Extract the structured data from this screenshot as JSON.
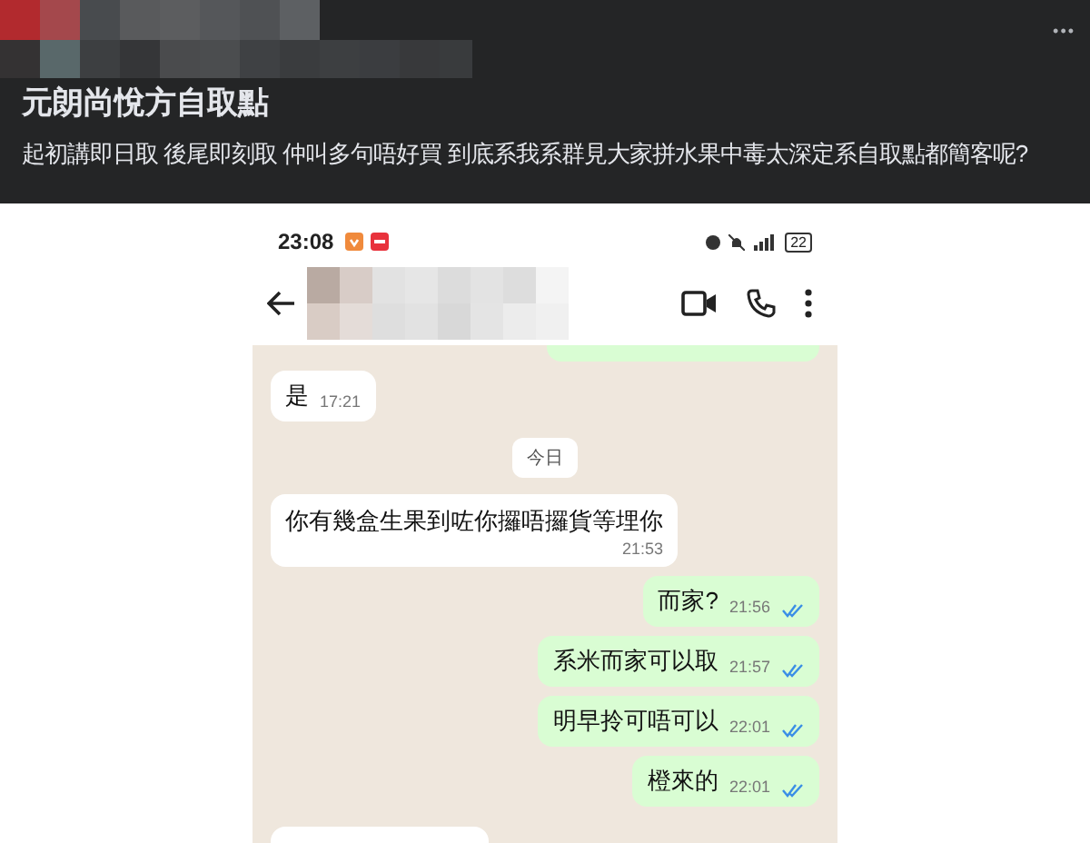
{
  "post": {
    "title": "元朗尚悅方自取點",
    "body": "起初講即日取 後尾即刻取 仲叫多句唔好買 到底系我系群見大家拼水果中毒太深定系自取點都簡客呢?",
    "menu_icon": "•••"
  },
  "phone": {
    "status_time": "23:08",
    "battery": "22",
    "messages": [
      {
        "kind": "sent_cut"
      },
      {
        "kind": "received",
        "text": "是",
        "time": "17:21"
      },
      {
        "kind": "date",
        "text": "今日"
      },
      {
        "kind": "received_wide",
        "text": "你有幾盒生果到咗你攞唔攞貨等埋你",
        "time": "21:53"
      },
      {
        "kind": "sent",
        "text": "而家?",
        "time": "21:56",
        "read": true
      },
      {
        "kind": "sent",
        "text": "系米而家可以取",
        "time": "21:57",
        "read": true
      },
      {
        "kind": "sent",
        "text": "明早拎可唔可以",
        "time": "22:01",
        "read": true
      },
      {
        "kind": "sent",
        "text": "橙來的",
        "time": "22:01",
        "read": true
      },
      {
        "kind": "received_cut"
      }
    ]
  }
}
